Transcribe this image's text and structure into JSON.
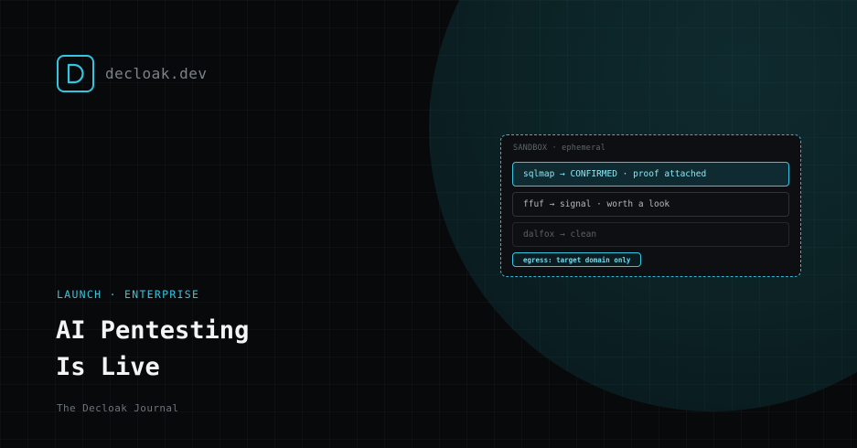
{
  "brand": {
    "logo_letter": "D",
    "logo_icon": "decloak-d-logo-icon",
    "name": "decloak.dev"
  },
  "sandbox": {
    "header": "SANDBOX · ephemeral",
    "rows": [
      {
        "text": "sqlmap → CONFIRMED · proof attached",
        "state": "confirmed"
      },
      {
        "text": "ffuf → signal · worth a look",
        "state": "signal"
      },
      {
        "text": "dalfox → clean",
        "state": "clean"
      }
    ],
    "egress_badge": "egress: target domain only"
  },
  "hero": {
    "kicker": "LAUNCH · ENTERPRISE",
    "title_line_1": "AI Pentesting",
    "title_line_2": "Is Live",
    "publication": "The Decloak Journal"
  },
  "colors": {
    "accent": "#33c6e0",
    "background": "#08090b",
    "title": "#f2f4f6",
    "muted": "#6d747b"
  }
}
